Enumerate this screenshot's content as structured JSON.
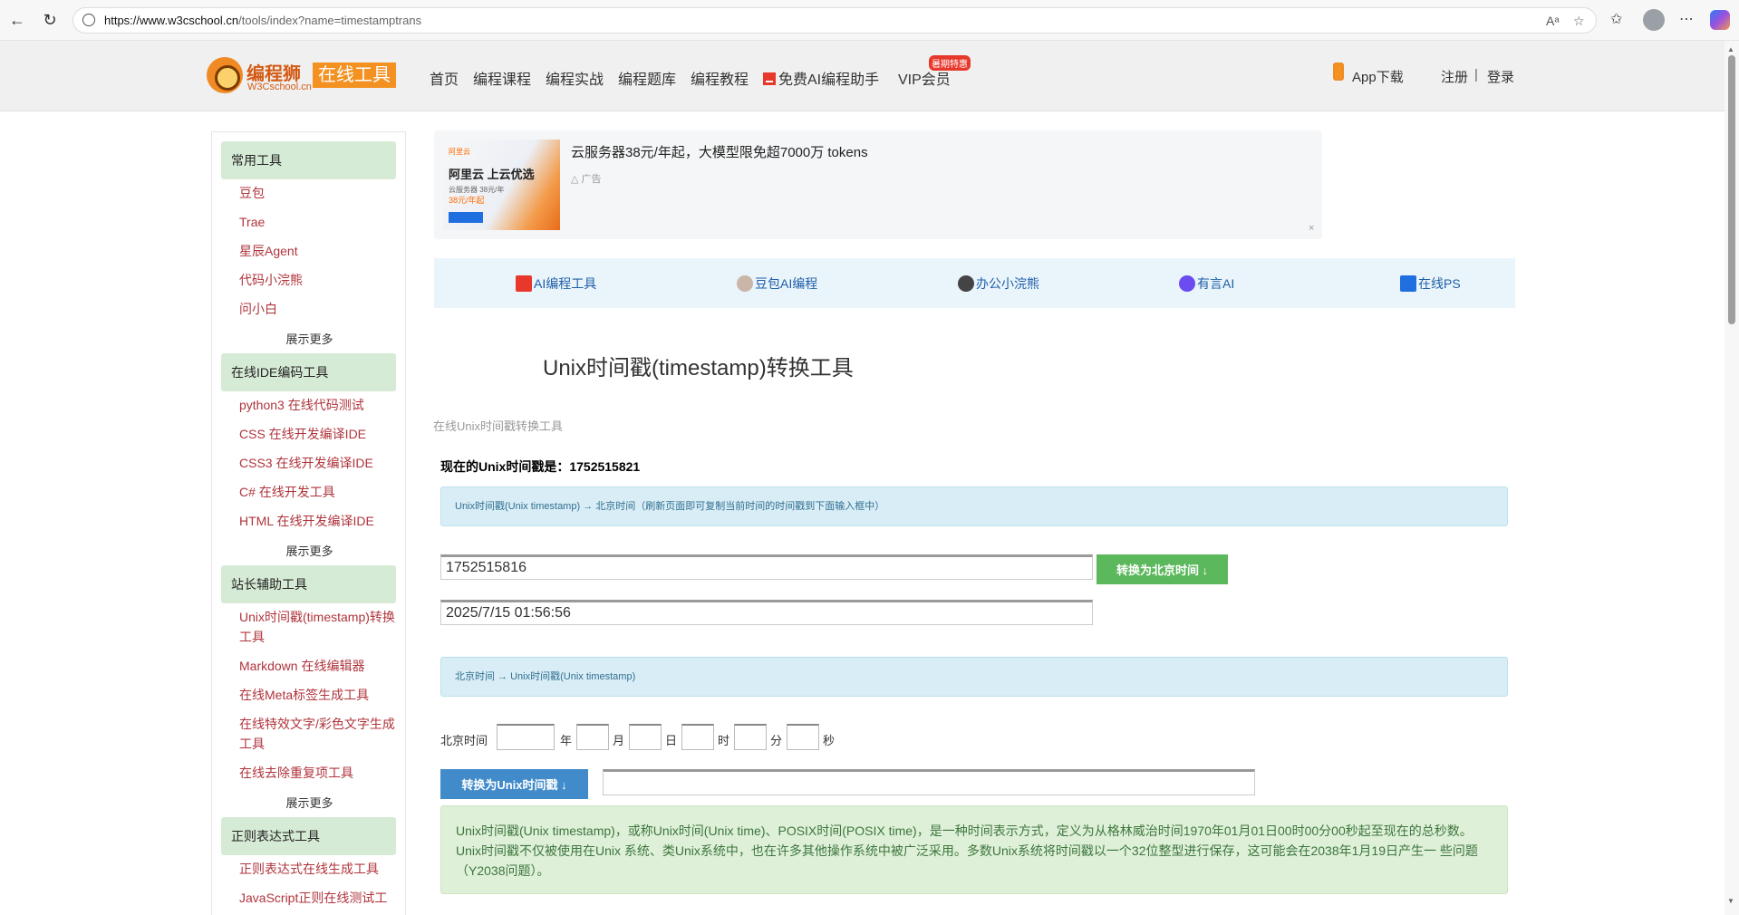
{
  "browser": {
    "url_domain": "https://www.w3cschool.cn",
    "url_rest": "/tools/index?name=timestamptrans"
  },
  "header": {
    "logo_title": "编程狮",
    "logo_sub": "W3Cschool.cn",
    "logo_tag": "在线工具",
    "nav": [
      "首页",
      "编程课程",
      "编程实战",
      "编程题库",
      "编程教程",
      "免费AI编程助手",
      "VIP会员"
    ],
    "vip_badge": "暑期特惠",
    "app_download": "App下载",
    "register": "注册",
    "separator": "|",
    "login": "登录"
  },
  "sidebar": {
    "sections": [
      {
        "title": "常用工具",
        "items": [
          "豆包",
          "Trae",
          "星辰Agent",
          "代码小浣熊",
          "问小白"
        ],
        "more": "展示更多"
      },
      {
        "title": "在线IDE编码工具",
        "items": [
          "python3 在线代码测试",
          "CSS 在线开发编译IDE",
          "CSS3 在线开发编译IDE",
          "C# 在线开发工具",
          "HTML 在线开发编译IDE"
        ],
        "more": "展示更多"
      },
      {
        "title": "站长辅助工具",
        "items": [
          "Unix时间戳(timestamp)转换工具",
          "Markdown 在线编辑器",
          "在线Meta标签生成工具",
          "在线特效文字/彩色文字生成工具",
          "在线去除重复项工具"
        ],
        "more": "展示更多"
      },
      {
        "title": "正则表达式工具",
        "items": [
          "正则表达式在线生成工具",
          "JavaScript正则在线测试工"
        ]
      }
    ]
  },
  "ad": {
    "image_brand": "阿里云",
    "image_headline": "阿里云 上云优选",
    "image_line1": "云服务器 38元/年",
    "image_line2": "38元/年起",
    "title": "云服务器38元/年起，大模型限免超7000万 tokens",
    "label": "广告",
    "close": "×"
  },
  "quick_links": [
    "AI编程工具",
    "豆包AI编程",
    "办公小浣熊",
    "有言AI",
    "在线PS"
  ],
  "tool": {
    "title": "Unix时间戳(timestamp)转换工具",
    "subtitle": "在线Unix时间戳转换工具",
    "now_label": "现在的Unix时间戳是：",
    "now_value": "1752515821",
    "info1": "Unix时间戳(Unix timestamp) → 北京时间（刷新页面即可复制当前时间的时间戳到下面输入框中）",
    "timestamp_input": "1752515816",
    "btn_to_beijing": "转换为北京时间 ↓",
    "beijing_result": "2025/7/15 01:56:56",
    "info2": "北京时间 → Unix时间戳(Unix timestamp)",
    "bj_label": "北京时间",
    "units": [
      "年",
      "月",
      "日",
      "时",
      "分",
      "秒"
    ],
    "btn_to_unix": "转换为Unix时间戳 ↓",
    "description": "Unix时间戳(Unix timestamp)，或称Unix时间(Unix time)、POSIX时间(POSIX time)，是一种时间表示方式，定义为从格林威治时间1970年01月01日00时00分00秒起至现在的总秒数。Unix时间戳不仅被使用在Unix 系统、类Unix系统中，也在许多其他操作系统中被广泛采用。多数Unix系统将时间戳以一个32位整型进行保存，这可能会在2038年1月19日产生一 些问题（Y2038问题）。"
  },
  "colors": {
    "orange": "#f39121",
    "side_head": "#d6ebd5",
    "side_link": "#b0343c",
    "info_blue": "#d9edf7",
    "success_green": "#dff0d8",
    "btn_green": "#5cb85c",
    "btn_blue": "#428bca"
  }
}
